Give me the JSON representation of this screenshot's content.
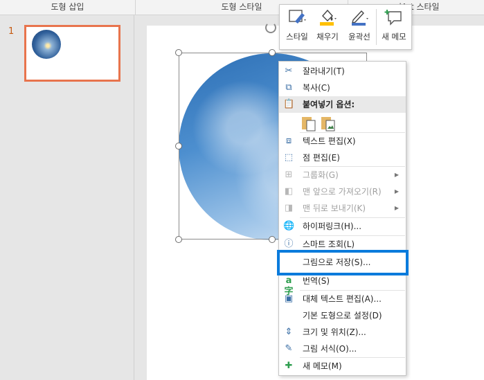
{
  "ribbon": {
    "groups": [
      "도형 삽입",
      "도형 스타일",
      "rdArt 스타일"
    ]
  },
  "thumbnail_pane": {
    "slide_number": "1"
  },
  "mini_toolbar": {
    "buttons": [
      {
        "label": "스타일",
        "icon": "shape-style-icon"
      },
      {
        "label": "채우기",
        "icon": "fill-bucket-icon"
      },
      {
        "label": "윤곽선",
        "icon": "outline-pen-icon"
      },
      {
        "label": "새 메모",
        "icon": "new-comment-icon"
      }
    ],
    "colors": {
      "fill": "#ffc000",
      "outline": "#4472c4"
    }
  },
  "context_menu": {
    "items": [
      {
        "label": "잘라내기(T)",
        "icon": "scissors-icon"
      },
      {
        "label": "복사(C)",
        "icon": "copy-icon"
      },
      {
        "label": "붙여넣기 옵션:",
        "icon": "paste-icon"
      },
      {
        "label": "텍스트 편집(X)",
        "icon": "text-edit-icon"
      },
      {
        "label": "점 편집(E)",
        "icon": "edit-points-icon"
      },
      {
        "label": "그룹화(G)",
        "icon": "group-icon",
        "disabled": true
      },
      {
        "label": "맨 앞으로 가져오기(R)",
        "icon": "bring-front-icon",
        "disabled": true
      },
      {
        "label": "맨 뒤로 보내기(K)",
        "icon": "send-back-icon",
        "disabled": true
      },
      {
        "label": "하이퍼링크(H)...",
        "icon": "hyperlink-icon"
      },
      {
        "label": "스마트 조회(L)",
        "icon": "smart-lookup-icon"
      },
      {
        "label": "그림으로 저장(S)...",
        "icon": ""
      },
      {
        "label": "번역(S)",
        "icon": "translate-icon"
      },
      {
        "label": "대체 텍스트 편집(A)...",
        "icon": "alt-text-icon"
      },
      {
        "label": "기본 도형으로 설정(D)",
        "icon": ""
      },
      {
        "label": "크기 및 위치(Z)...",
        "icon": "size-position-icon"
      },
      {
        "label": "그림 서식(O)...",
        "icon": "format-picture-icon"
      },
      {
        "label": "새 메모(M)",
        "icon": "new-comment-icon"
      }
    ],
    "highlight_color": "#0a7bdc"
  },
  "accent": "#e8744d"
}
